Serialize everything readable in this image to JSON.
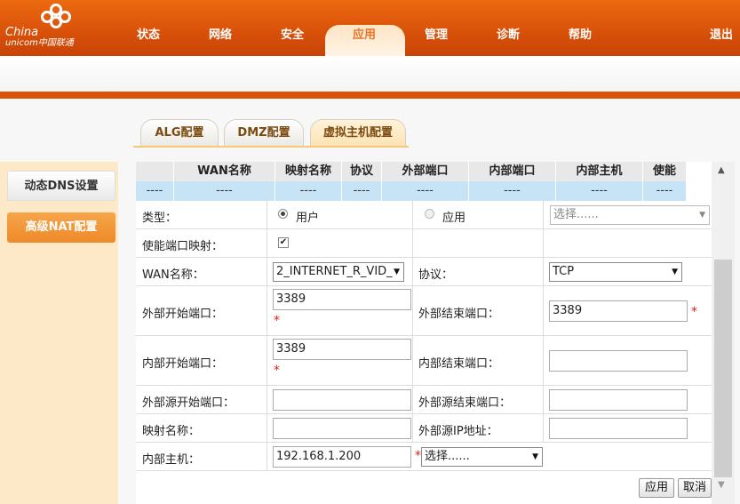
{
  "brand": {
    "line1": "China",
    "line2": "unicom中国联通"
  },
  "nav": {
    "items": [
      {
        "label": "状态"
      },
      {
        "label": "网络"
      },
      {
        "label": "安全"
      },
      {
        "label": "应用"
      },
      {
        "label": "管理"
      },
      {
        "label": "诊断"
      },
      {
        "label": "帮助"
      }
    ],
    "active_index": 3,
    "logout_label": "退出"
  },
  "tabs": [
    {
      "label": "ALG配置"
    },
    {
      "label": "DMZ配置"
    },
    {
      "label": "虚拟主机配置"
    }
  ],
  "sidebar": {
    "items": [
      {
        "label": "动态DNS设置"
      },
      {
        "label": "高级NAT配置"
      }
    ],
    "active_index": 1
  },
  "table": {
    "headers": [
      "",
      "WAN名称",
      "映射名称",
      "协议",
      "外部端口",
      "内部端口",
      "内部主机",
      "使能"
    ],
    "row": [
      "",
      "----",
      "----",
      "----",
      "----",
      "----",
      "----",
      "----"
    ]
  },
  "form": {
    "type_label": "类型：",
    "type_user": "用户",
    "type_app": "应用",
    "type_app_select": "选择......",
    "enable_port_label": "使能端口映射：",
    "enable_port_checked": "✔",
    "wan_label": "WAN名称：",
    "wan_value": "2_INTERNET_R_VID_",
    "protocol_label": "协议：",
    "protocol_value": "TCP",
    "ext_start_label": "外部开始端口：",
    "ext_start_value": "3389",
    "ext_end_label": "外部结束端口：",
    "ext_end_value": "3389",
    "int_start_label": "内部开始端口：",
    "int_start_value": "3389",
    "int_end_label": "内部结束端口：",
    "int_end_value": "",
    "src_start_label": "外部源开始端口：",
    "src_start_value": "",
    "src_end_label": "外部源结束端口：",
    "src_end_value": "",
    "mapping_name_label": "映射名称：",
    "mapping_name_value": "",
    "src_ip_label": "外部源IP地址：",
    "src_ip_value": "",
    "int_host_label": "内部主机：",
    "int_host_value": "192.168.1.200",
    "int_host_select": "选择......",
    "required_mark": "*",
    "dropdown_arrow": "▼"
  },
  "buttons": {
    "apply": "应用",
    "cancel": "取消"
  },
  "colors": {
    "brand_orange": "#d9520a",
    "active_tab": "#fde3b5",
    "sidebar_bg": "#fde8c8",
    "header_blue": "#c7e4f7"
  }
}
